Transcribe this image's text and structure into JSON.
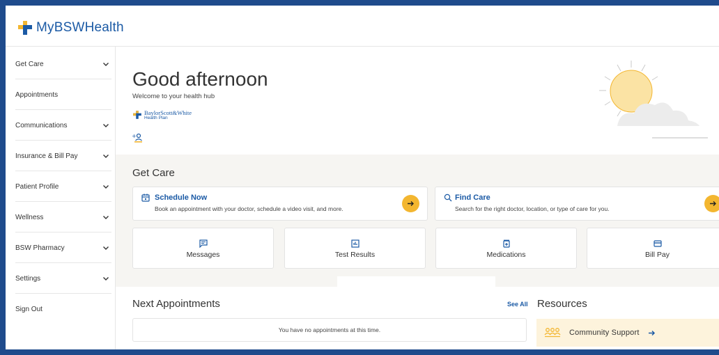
{
  "app": {
    "logo_text": "MyBSWHealth"
  },
  "sidebar": {
    "items": [
      {
        "label": "Get Care",
        "has_chevron": true
      },
      {
        "label": "Appointments",
        "has_chevron": false
      },
      {
        "label": "Communications",
        "has_chevron": true
      },
      {
        "label": "Insurance & Bill Pay",
        "has_chevron": true
      },
      {
        "label": "Patient Profile",
        "has_chevron": true
      },
      {
        "label": "Wellness",
        "has_chevron": true
      },
      {
        "label": "BSW Pharmacy",
        "has_chevron": true
      },
      {
        "label": "Settings",
        "has_chevron": true
      },
      {
        "label": "Sign Out",
        "has_chevron": false
      }
    ]
  },
  "greeting": {
    "title": "Good afternoon",
    "subtitle": "Welcome to your health hub",
    "plan_name_line1": "BaylorScott&White",
    "plan_name_line2": "Health Plan",
    "add_person_icon": "add-person-icon",
    "illustration": "sun-cloud-illustration"
  },
  "get_care": {
    "title": "Get Care",
    "schedule": {
      "title": "Schedule Now",
      "description": "Book an appointment with your doctor, schedule a video visit, and more.",
      "icon": "calendar-icon"
    },
    "find_care": {
      "title": "Find Care",
      "description": "Search for the right doctor, location, or type of care for you.",
      "icon": "search-icon"
    },
    "tiles": [
      {
        "label": "Messages",
        "icon": "message-icon"
      },
      {
        "label": "Test Results",
        "icon": "chart-icon"
      },
      {
        "label": "Medications",
        "icon": "medication-icon"
      },
      {
        "label": "Bill Pay",
        "icon": "credit-card-icon"
      }
    ]
  },
  "appointments": {
    "title": "Next Appointments",
    "see_all": "See All",
    "empty_message": "You have no appointments at this time."
  },
  "resources": {
    "title": "Resources",
    "community_support": "Community Support"
  },
  "colors": {
    "brand_blue": "#1b5aa5",
    "accent_yellow": "#f3b630",
    "frame_border": "#1f4b8c",
    "section_bg": "#f6f5f2",
    "resource_bg": "#fdf3dc"
  }
}
